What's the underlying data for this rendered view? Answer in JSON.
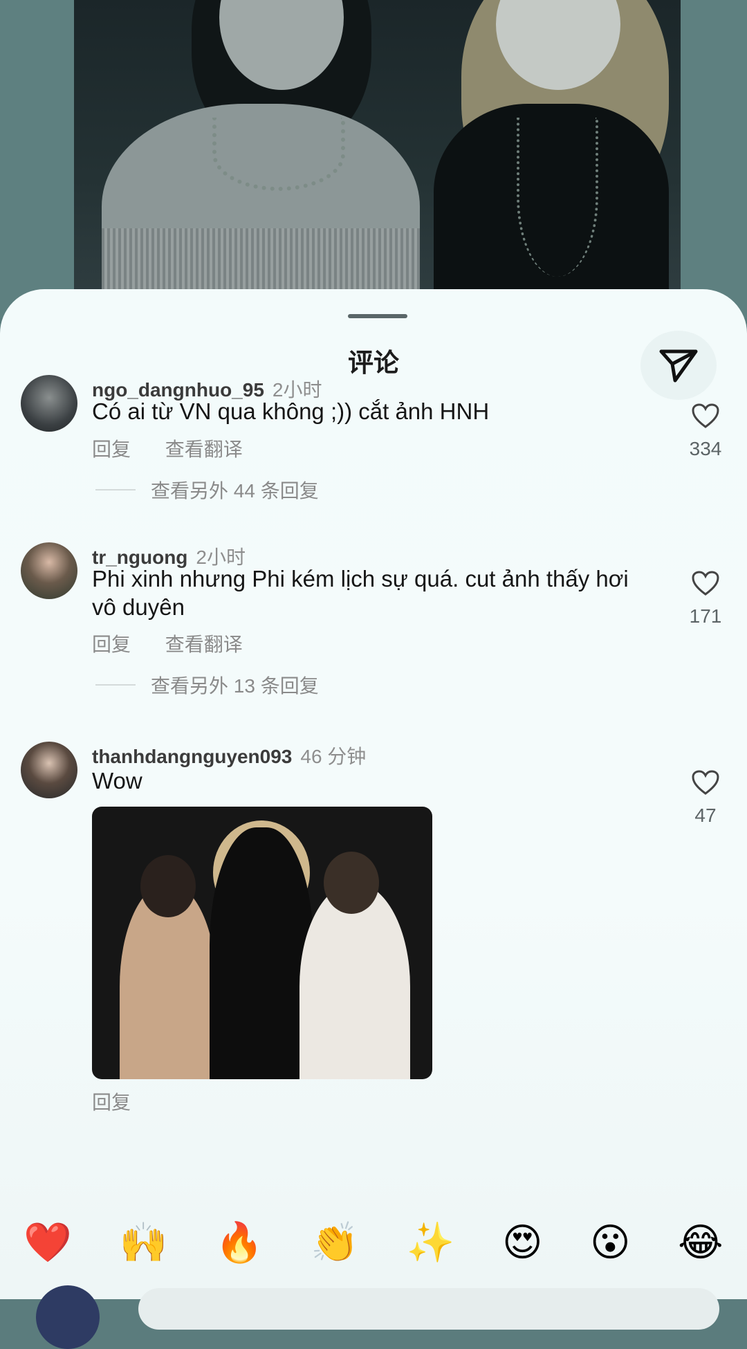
{
  "sheet": {
    "title": "评论"
  },
  "comments": [
    {
      "username": "ngo_dangnhuo_95",
      "time": "2小时",
      "text": "Có ai từ VN qua không ;)) cắt ảnh HNH",
      "reply_label": "回复",
      "translate_label": "查看翻译",
      "more_replies": "查看另外 44 条回复",
      "likes": "334"
    },
    {
      "username": "tr_nguong",
      "time": "2小时",
      "text": "Phi xinh nhưng Phi kém lịch sự quá. cut ảnh thấy hơi vô duyên",
      "reply_label": "回复",
      "translate_label": "查看翻译",
      "more_replies": "查看另外 13 条回复",
      "likes": "171"
    },
    {
      "username": "thanhdangnguyen093",
      "time": "46 分钟",
      "text": "Wow",
      "reply_label": "回复",
      "likes": "47"
    }
  ],
  "emoji_bar": [
    "❤️",
    "🙌",
    "🔥",
    "👏",
    "✨",
    "😍",
    "😮",
    "😂"
  ],
  "icons": {
    "send": "send-icon",
    "like": "heart-outline-icon"
  }
}
